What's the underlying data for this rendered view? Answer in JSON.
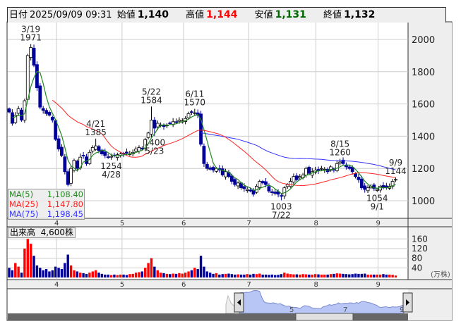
{
  "header": {
    "date_label": "日付",
    "datetime": "2025/09/09 09:31",
    "open_label": "始値",
    "open": "1,140",
    "high_label": "高値",
    "high": "1,144",
    "low_label": "安値",
    "low": "1,131",
    "close_label": "終値",
    "close": "1,132"
  },
  "colors": {
    "up": "#ff0000",
    "down": "#000099",
    "ma5": "#228822",
    "ma25": "#ff2222",
    "ma75": "#3333ff",
    "high": "#ff0000",
    "low": "#006600"
  },
  "ma_legend": [
    {
      "label": "MA(5)",
      "value": "1,108.40"
    },
    {
      "label": "MA(25)",
      "value": "1,147.80"
    },
    {
      "label": "MA(75)",
      "value": "1,198.45"
    }
  ],
  "volume": {
    "label": "出来高",
    "value": "4,600株",
    "unit": "(万株)",
    "ticks": [
      "160",
      "120",
      "80",
      "40"
    ]
  },
  "navigator": {
    "labels": [
      "5",
      "7",
      "9"
    ]
  },
  "chart_data": {
    "type": "candlestick",
    "y_ticks": [
      "2000",
      "1800",
      "1600",
      "1400",
      "1200",
      "1000"
    ],
    "ylim": [
      900,
      2100
    ],
    "months": [
      {
        "label": "4",
        "index": 15.3
      },
      {
        "label": "5",
        "index": 36.5
      },
      {
        "label": "6",
        "index": 56.4
      },
      {
        "label": "7",
        "index": 77.5
      },
      {
        "label": "8",
        "index": 99.2
      },
      {
        "label": "9",
        "index": 119.3
      }
    ],
    "close": [
      1550,
      1480,
      1530,
      1570,
      1500,
      1620,
      1900,
      1950,
      1840,
      1700,
      1580,
      1560,
      1540,
      1530,
      1500,
      1380,
      1320,
      1280,
      1180,
      1100,
      1200,
      1250,
      1200,
      1270,
      1280,
      1230,
      1300,
      1330,
      1340,
      1310,
      1290,
      1280,
      1270,
      1275,
      1280,
      1285,
      1290,
      1290,
      1295,
      1290,
      1300,
      1320,
      1330,
      1320,
      1380,
      1420,
      1500,
      1450,
      1480,
      1470,
      1460,
      1470,
      1480,
      1490,
      1485,
      1500,
      1495,
      1510,
      1540,
      1550,
      1545,
      1530,
      1350,
      1230,
      1200,
      1195,
      1190,
      1200,
      1190,
      1160,
      1180,
      1150,
      1120,
      1100,
      1110,
      1080,
      1075,
      1070,
      1060,
      1040,
      1090,
      1120,
      1110,
      1100,
      1060,
      1050,
      1045,
      1040,
      1030,
      1080,
      1100,
      1120,
      1150,
      1130,
      1150,
      1160,
      1200,
      1170,
      1180,
      1190,
      1185,
      1200,
      1195,
      1180,
      1210,
      1190,
      1230,
      1240,
      1230,
      1210,
      1200,
      1180,
      1150,
      1130,
      1080,
      1070,
      1080,
      1090,
      1075,
      1070,
      1090,
      1080,
      1085,
      1090,
      1120,
      1132
    ],
    "volume_man": [
      40,
      30,
      60,
      45,
      20,
      120,
      160,
      140,
      90,
      50,
      40,
      30,
      35,
      25,
      30,
      45,
      40,
      35,
      60,
      95,
      50,
      30,
      25,
      20,
      18,
      15,
      20,
      25,
      30,
      20,
      15,
      12,
      12,
      10,
      12,
      10,
      12,
      12,
      10,
      14,
      15,
      20,
      22,
      25,
      40,
      60,
      80,
      45,
      30,
      20,
      18,
      15,
      14,
      16,
      15,
      18,
      16,
      20,
      25,
      30,
      40,
      35,
      90,
      45,
      25,
      20,
      15,
      18,
      12,
      14,
      15,
      16,
      14,
      12,
      13,
      12,
      12,
      14,
      12,
      15,
      14,
      16,
      12,
      12,
      11,
      12,
      10,
      11,
      14,
      20,
      16,
      14,
      13,
      13,
      12,
      14,
      13,
      12,
      12,
      14,
      13,
      12,
      12,
      12,
      14,
      15,
      17,
      16,
      15,
      14,
      13,
      14,
      16,
      15,
      15,
      16,
      12,
      12,
      12,
      12,
      12,
      14,
      12,
      12,
      11,
      8
    ],
    "annotations": [
      {
        "index": 7,
        "date": "3/19",
        "value": "1971",
        "price": 1971,
        "pos": "above"
      },
      {
        "index": 28,
        "date": "4/21",
        "value": "1385",
        "price": 1385,
        "pos": "above"
      },
      {
        "index": 33,
        "date": "4/28",
        "value": "1254",
        "price": 1254,
        "pos": "below"
      },
      {
        "index": 46,
        "date": "5/22",
        "value": "1584",
        "price": 1584,
        "pos": "above"
      },
      {
        "index": 47,
        "date": "5/23",
        "value": "1400",
        "price": 1400,
        "pos": "below"
      },
      {
        "index": 60,
        "date": "6/11",
        "value": "1570",
        "price": 1570,
        "pos": "above"
      },
      {
        "index": 88,
        "date": "7/22",
        "value": "1003",
        "price": 1003,
        "pos": "below"
      },
      {
        "index": 107,
        "date": "8/15",
        "value": "1260",
        "price": 1260,
        "pos": "above"
      },
      {
        "index": 119,
        "date": "9/1",
        "value": "1054",
        "price": 1054,
        "pos": "below"
      },
      {
        "index": 125,
        "date": "9/9",
        "value": "1144",
        "price": 1144,
        "pos": "above"
      }
    ]
  }
}
